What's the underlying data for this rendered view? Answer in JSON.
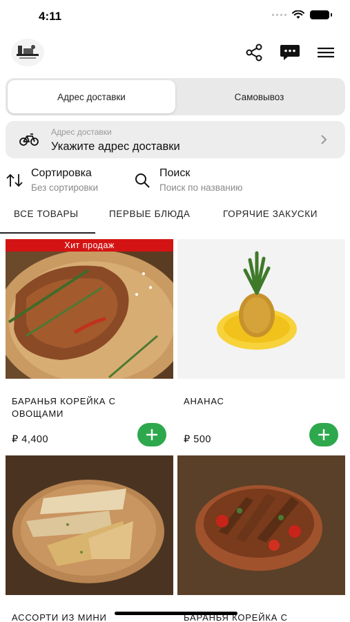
{
  "status": {
    "time": "4:11"
  },
  "header": {
    "logo_icon": "restaurant-logo",
    "actions": [
      {
        "name": "share-icon"
      },
      {
        "name": "chat-icon"
      },
      {
        "name": "menu-icon"
      }
    ]
  },
  "delivery_mode": {
    "options": [
      "Адрес доставки",
      "Самовывоз"
    ],
    "selected": "Адрес доставки"
  },
  "address": {
    "label": "Адрес доставки",
    "value": "Укажите адрес доставки",
    "icon": "bicycle-icon"
  },
  "tools": {
    "sort": {
      "title": "Сортировка",
      "subtitle": "Без сортировки",
      "icon": "sort-arrows-icon"
    },
    "search": {
      "title": "Поиск",
      "subtitle": "Поиск по названию",
      "icon": "search-icon"
    }
  },
  "tabs": [
    {
      "label": "ВСЕ ТОВАРЫ",
      "active": true
    },
    {
      "label": "ПЕРВЫЕ БЛЮДА",
      "active": false
    },
    {
      "label": "ГОРЯЧИЕ ЗАКУСКИ",
      "active": false
    }
  ],
  "products": [
    {
      "name": "БАРАНЬЯ КОРЕЙКА С ОВОЩАМИ",
      "price": "₽ 4,400",
      "badge": "Хит продаж"
    },
    {
      "name": "АНАНАС",
      "price": "₽ 500",
      "badge": ""
    },
    {
      "name": "АССОРТИ ИЗ МИНИ",
      "price": "",
      "badge": ""
    },
    {
      "name": "БАРАНЬЯ КОРЕЙКА С",
      "price": "",
      "badge": ""
    }
  ],
  "colors": {
    "accent_green": "#2ea84c",
    "badge_red": "#d41414",
    "segment_bg": "#e9e9e9"
  }
}
